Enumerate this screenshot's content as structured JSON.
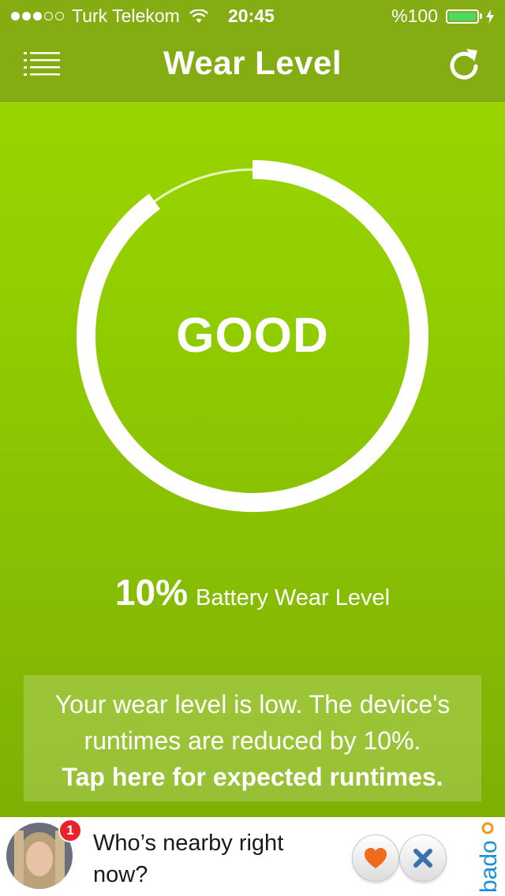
{
  "status_bar": {
    "carrier": "Turk Telekom",
    "time": "20:45",
    "battery_percent": "%100",
    "signal_filled": 3,
    "signal_total": 5
  },
  "header": {
    "title": "Wear Level",
    "left_icon": "list-menu-icon",
    "right_icon": "refresh-icon"
  },
  "gauge": {
    "status": "GOOD",
    "wear_fraction": 0.1
  },
  "wear": {
    "percent": "10%",
    "label": "Battery Wear Level"
  },
  "info": {
    "line1": "Your wear level is low. The device's",
    "line2": "runtimes are reduced by 10%.",
    "cta": "Tap here for expected runtimes."
  },
  "ad": {
    "text": "Who’s nearby right now?",
    "badge_count": "1",
    "brand": "badoo",
    "like_icon": "heart-icon",
    "dislike_icon": "x-icon"
  },
  "colors": {
    "background": "#92cf00",
    "navbar": "#84ad14",
    "accent_white": "#ffffff",
    "battery_green": "#4cd964",
    "heart": "#f26a1b",
    "x_blue": "#3b6fb0",
    "badoo_blue": "#1b8fd7",
    "badoo_orange": "#f7941d"
  }
}
